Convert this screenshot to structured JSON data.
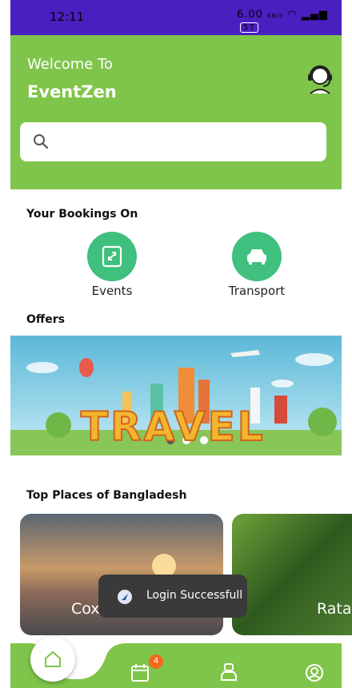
{
  "status_bar": {
    "time": "12:11",
    "network_speed": "6.00",
    "network_unit": "KB/S",
    "battery": "57"
  },
  "header": {
    "welcome": "Welcome To",
    "app_name": "EventZen"
  },
  "search": {
    "placeholder": ""
  },
  "bookings": {
    "title": "Your Bookings On",
    "items": [
      {
        "label": "Events",
        "icon": "ticket-icon"
      },
      {
        "label": "Transport",
        "icon": "car-icon"
      }
    ]
  },
  "offers": {
    "title": "Offers",
    "banner_text": "TRAVEL"
  },
  "top_places": {
    "title": "Top Places of Bangladesh",
    "cards": [
      {
        "label": "Cox"
      },
      {
        "label": "Rata"
      }
    ]
  },
  "toast": {
    "text": "Login Successfull"
  },
  "bottom_nav": {
    "items": [
      "home-icon",
      "calendar-icon",
      "transport-icon",
      "profile-icon"
    ],
    "calendar_badge": "4"
  },
  "colors": {
    "status_bar": "#4a1fc0",
    "header": "#80c54b",
    "accent": "#3fc07e",
    "badge": "#f26a1b"
  }
}
